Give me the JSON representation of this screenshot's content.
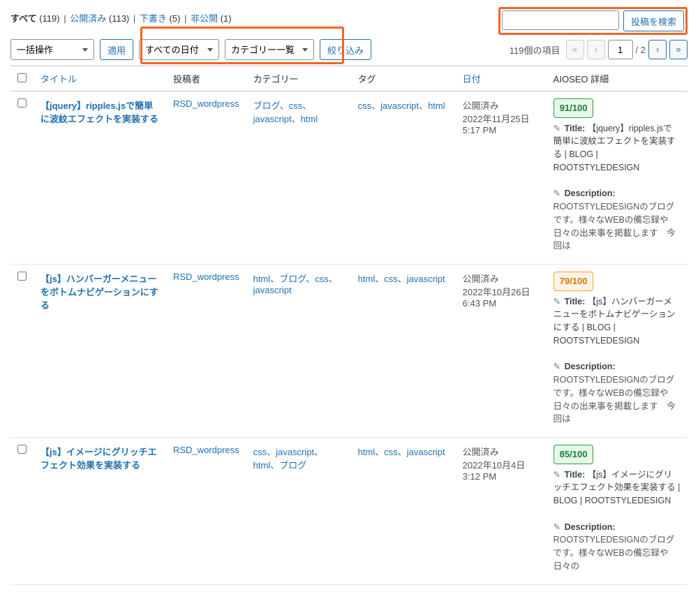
{
  "statusLinks": {
    "all": {
      "label": "すべて",
      "count": "(119)"
    },
    "published": {
      "label": "公開済み",
      "count": "(113)"
    },
    "draft": {
      "label": "下書き",
      "count": "(5)"
    },
    "private": {
      "label": "非公開",
      "count": "(1)"
    }
  },
  "search": {
    "button": "投稿を検索",
    "value": ""
  },
  "filters": {
    "bulk": "一括操作",
    "apply": "適用",
    "date": "すべての日付",
    "category": "カテゴリー一覧",
    "filter": "絞り込み"
  },
  "pager": {
    "count": "119個の項目",
    "page": "1",
    "total": "/ 2"
  },
  "columns": {
    "title": "タイトル",
    "author": "投稿者",
    "categories": "カテゴリー",
    "tags": "タグ",
    "date": "日付",
    "aioseo": "AIOSEO 詳細"
  },
  "rows": [
    {
      "title": "【jquery】ripples.jsで簡単に波紋エフェクトを実装する",
      "author": "RSD_wordpress",
      "categories": "ブログ、css、javascript、html",
      "tags": "css、javascript、html",
      "status": "公開済み",
      "date": "2022年11月25日 5:17 PM",
      "score": "91/100",
      "scoreClass": "green",
      "seoTitleLabel": "Title:",
      "seoTitle": "【jquery】ripples.jsで簡単に波紋エフェクトを実装する | BLOG | ROOTSTYLEDESIGN",
      "seoDescLabel": "Description:",
      "seoDesc": "ROOTSTYLEDESIGNのブログです。様々なWEBの備忘録や日々の出来事を掲載します　今回は"
    },
    {
      "title": "【js】ハンバーガーメニューをボトムナビゲーションにする",
      "author": "RSD_wordpress",
      "categories": "html、ブログ、css、javascript",
      "tags": "html、css、javascript",
      "status": "公開済み",
      "date": "2022年10月26日 6:43 PM",
      "score": "79/100",
      "scoreClass": "orange",
      "seoTitleLabel": "Title:",
      "seoTitle": "【js】ハンバーガーメニューをボトムナビゲーションにする | BLOG | ROOTSTYLEDESIGN",
      "seoDescLabel": "Description:",
      "seoDesc": "ROOTSTYLEDESIGNのブログです。様々なWEBの備忘録や日々の出来事を掲載します　今回は"
    },
    {
      "title": "【js】イメージにグリッチエフェクト効果を実装する",
      "author": "RSD_wordpress",
      "categories": "css、javascript、html、ブログ",
      "tags": "html、css、javascript",
      "status": "公開済み",
      "date": "2022年10月4日 3:12 PM",
      "score": "85/100",
      "scoreClass": "green",
      "seoTitleLabel": "Title:",
      "seoTitle": "【js】イメージにグリッチエフェクト効果を実装する | BLOG | ROOTSTYLEDESIGN",
      "seoDescLabel": "Description:",
      "seoDesc": "ROOTSTYLEDESIGNのブログです。様々なWEBの備忘録や日々の"
    }
  ]
}
